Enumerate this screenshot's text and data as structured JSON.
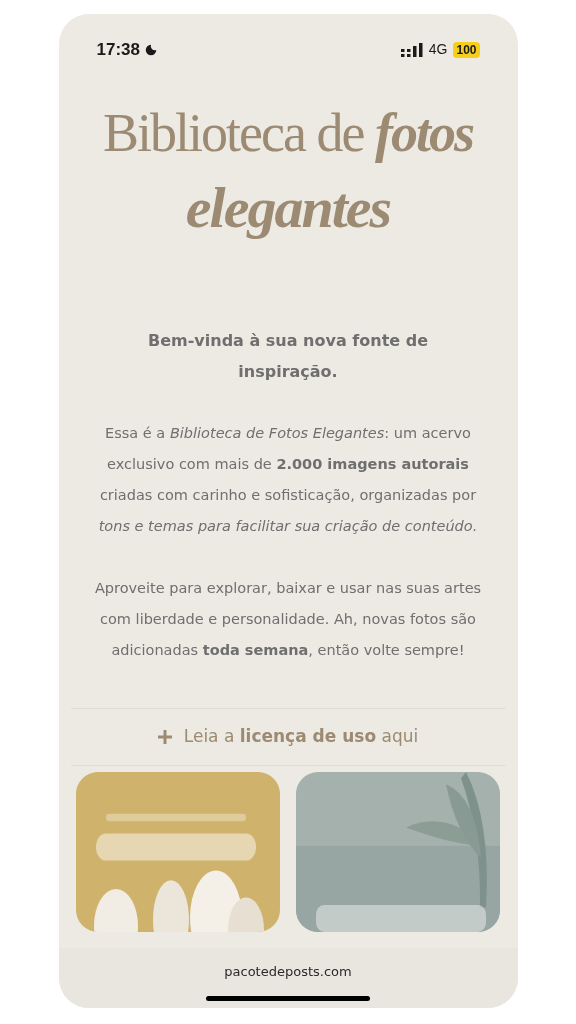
{
  "status_bar": {
    "time": "17:38",
    "network": "4G",
    "battery": "100"
  },
  "title": {
    "line1_regular": "Biblioteca de",
    "line1_bold": "fotos",
    "line2_bold": "elegantes"
  },
  "intro": "**Bem-vinda à sua nova fonte de inspiração.**",
  "paragraphs": [
    "Essa é a *Biblioteca de Fotos Elegantes*: um acervo exclusivo com mais de **2.000 imagens autorais** criadas com carinho e sofisticação, organizadas por *tons e temas para facilitar sua criação de conteúdo.*",
    "Aproveite para explorar, baixar e usar nas suas artes com liberdade e personalidade. Ah, novas fotos são adicionadas **toda semana**, então volte sempre!"
  ],
  "license_toggle": {
    "label": "Leia a **licença de uso** aqui",
    "expanded": false
  },
  "cards": [
    {
      "kind": "yellow"
    },
    {
      "kind": "green"
    }
  ],
  "browser_bar": {
    "url": "pacotedeposts.com"
  }
}
